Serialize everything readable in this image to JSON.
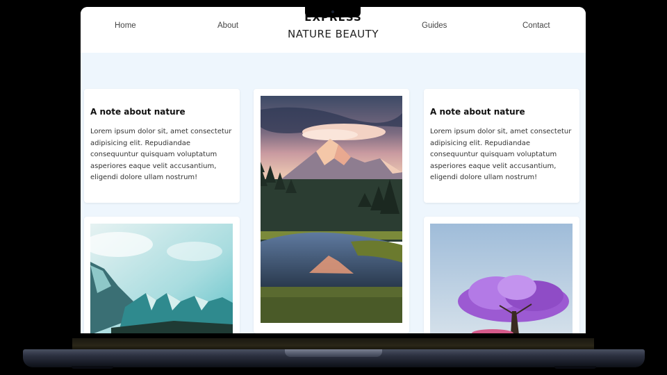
{
  "nav": {
    "home": "Home",
    "about": "About",
    "guides": "Guides",
    "contact": "Contact"
  },
  "brand": {
    "title": "EXPRESS",
    "subtitle": "NATURE BEAUTY"
  },
  "cards": {
    "left_note": {
      "title": "A note about nature",
      "body": "Lorem ipsum dolor sit, amet consectetur adipisicing elit. Repudiandae consequuntur quisquam voluptatum asperiores eaque velit accusantium, eligendi dolore ullam nostrum!"
    },
    "right_note": {
      "title": "A note about nature",
      "body": "Lorem ipsum dolor sit, amet consectetur adipisicing elit. Repudiandae consequuntur quisquam voluptatum asperiores eaque velit accusantium, eligendi dolore ullam nostrum!"
    }
  },
  "images": {
    "center": "mountain-lake-sunset",
    "left": "teal-mountain-range",
    "right": "purple-tree"
  },
  "colors": {
    "page_background": "#eef6fd",
    "card_background": "#ffffff",
    "text": "#111111"
  }
}
